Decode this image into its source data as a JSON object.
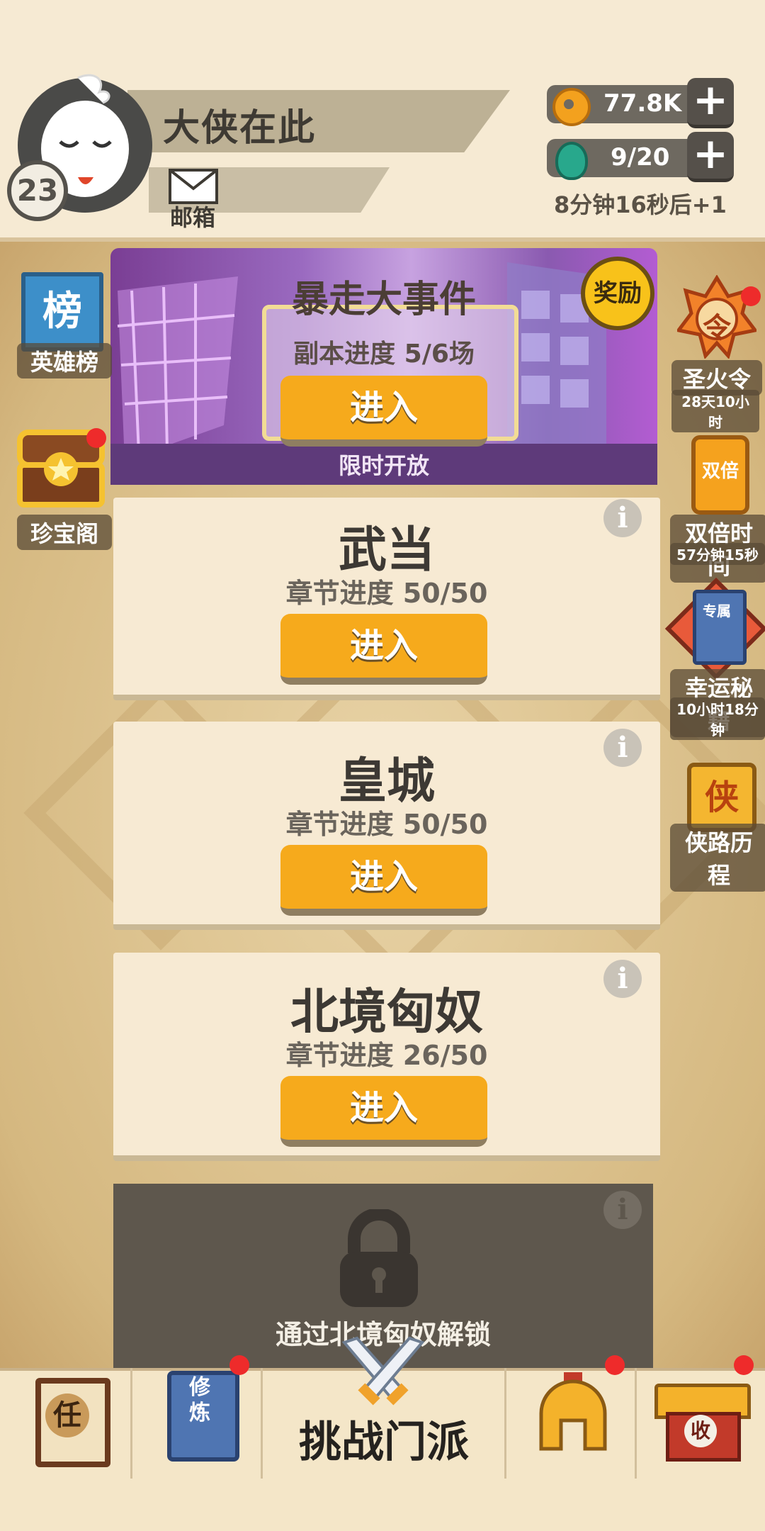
{
  "header": {
    "player_name": "大侠在此",
    "level": "23",
    "mail_label": "邮箱",
    "coins": "77.8K",
    "energy": "9/20",
    "regen_text": "8分钟16秒后+1",
    "plus_symbol": "+"
  },
  "event": {
    "title": "暴走大事件",
    "progress": "副本进度 5/6场",
    "enter_label": "进入",
    "note": "限时开放",
    "reward_label": "奖励"
  },
  "chapters": [
    {
      "title": "武当",
      "progress": "章节进度 50/50",
      "enter_label": "进入",
      "info": "i"
    },
    {
      "title": "皇城",
      "progress": "章节进度 50/50",
      "enter_label": "进入",
      "info": "i"
    },
    {
      "title": "北境匈奴",
      "progress": "章节进度 26/50",
      "enter_label": "进入",
      "info": "i"
    }
  ],
  "locked": {
    "text": "通过北境匈奴解锁",
    "info": "i"
  },
  "left_side": [
    {
      "label": "英雄榜",
      "glyph": "榜"
    },
    {
      "label": "珍宝阁"
    }
  ],
  "right_side": [
    {
      "label": "圣火令",
      "sub": "28天10小时",
      "glyph": "令"
    },
    {
      "label": "双倍时间",
      "sub": "57分钟15秒",
      "glyph": "双倍"
    },
    {
      "label": "幸运秘籍",
      "sub": "10小时18分钟",
      "glyph": "专属"
    },
    {
      "label": "侠路历程",
      "glyph": "侠"
    }
  ],
  "bottom_nav": {
    "task_glyph": "任",
    "train_glyph": "修炼",
    "challenge_label": "挑战门派",
    "collect_glyph": "收"
  },
  "colors": {
    "accent_orange": "#f6aa1c",
    "notify_red": "#ee2b2b"
  }
}
